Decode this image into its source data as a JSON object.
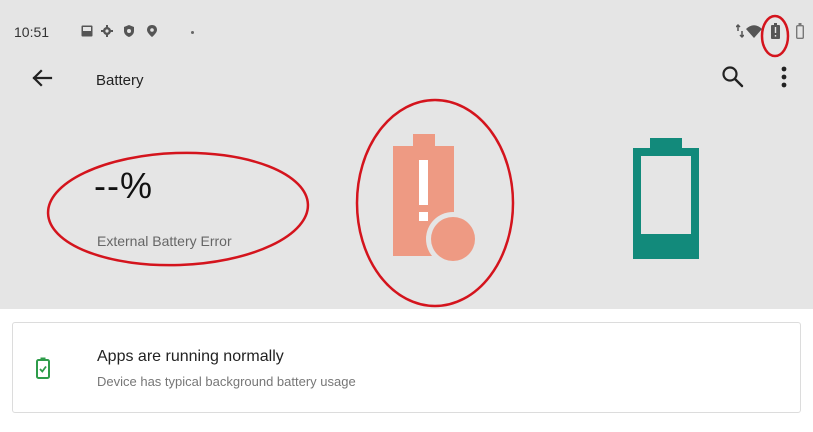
{
  "status_bar": {
    "time": "10:51",
    "left_icons": [
      "image-icon",
      "settings-gear-icon",
      "shield-icon",
      "location-pin-icon",
      "dot-icon"
    ],
    "right_icons": [
      "data-arrows-icon",
      "wifi-icon",
      "battery-alert-icon",
      "battery-icon"
    ]
  },
  "toolbar": {
    "title": "Battery",
    "back_icon": "arrow-left-icon",
    "search_icon": "search-icon",
    "more_icon": "more-vert-icon"
  },
  "hero": {
    "percent": "--%",
    "status": "External Battery Error",
    "error_battery_icon": "battery-alert-icon",
    "battery_icon": "battery-full-icon",
    "error_color": "#ee9a83",
    "battery_color": "#128a7b"
  },
  "tip_card": {
    "title": "Apps are running normally",
    "subtitle": "Device has typical background battery usage",
    "icon": "battery-check-icon",
    "icon_color": "#2e9c4a"
  },
  "colors": {
    "header_background": "#e5e5e5",
    "annotation": "#d4141d"
  }
}
